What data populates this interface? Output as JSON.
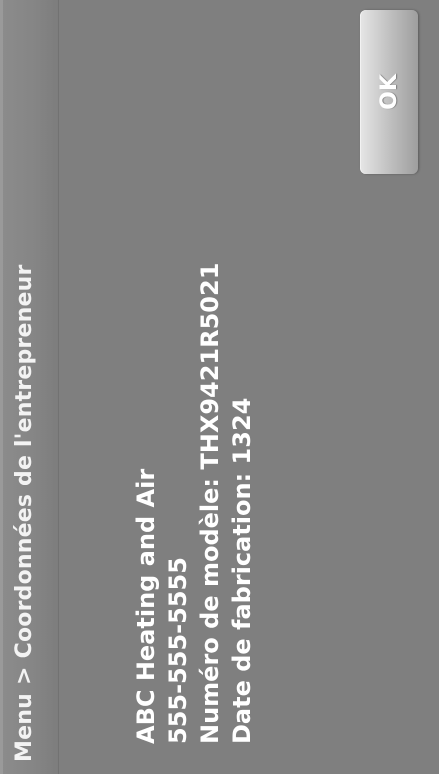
{
  "header": {
    "breadcrumb_root": "Menu",
    "separator": ">",
    "title": "Coordonnées de l'entrepreneur"
  },
  "contractor": {
    "name": "ABC Heating and Air",
    "phone": "555-555-5555",
    "model_number": "Numéro de modèle: THX9421R5021",
    "manufacture_date": "Date de fabrication: 1324"
  },
  "actions": {
    "ok_label": "OK"
  },
  "colors": {
    "background": "#7f7f7f",
    "text": "#ffffff"
  }
}
